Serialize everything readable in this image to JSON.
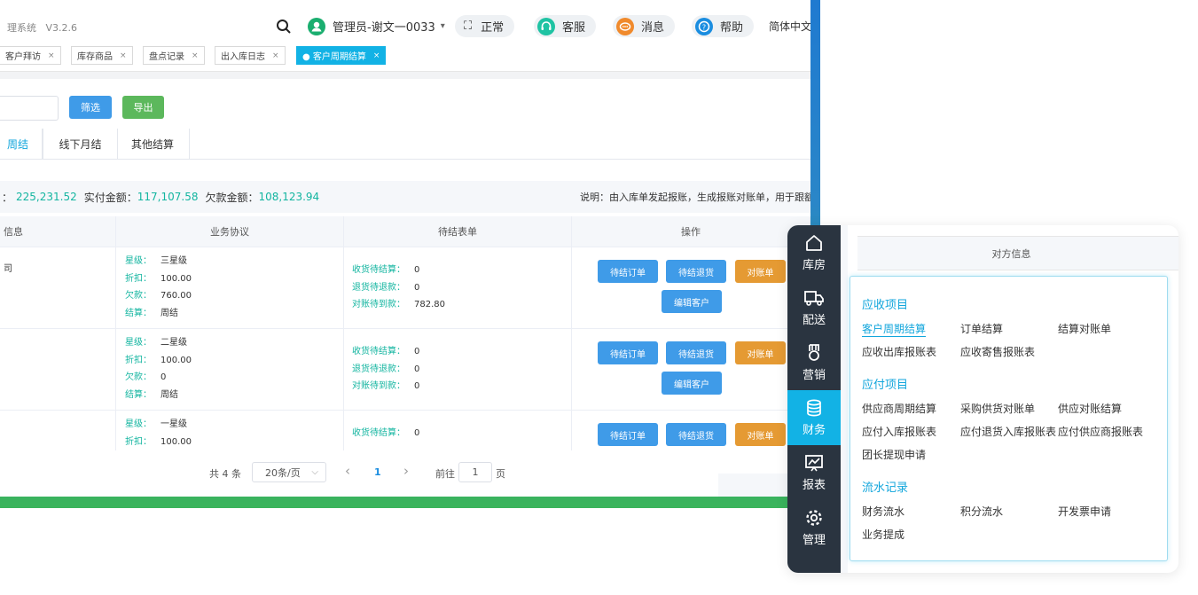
{
  "app": {
    "system_name": "理系统",
    "version": "V3.2.6"
  },
  "topbar": {
    "user": "管理员-谢文一0033",
    "status": "正常",
    "service": "客服",
    "messages": "消息",
    "help": "帮助",
    "language": "简体中文"
  },
  "tabs": [
    {
      "label": "客户拜访",
      "close": "×"
    },
    {
      "label": "库存商品",
      "close": "×"
    },
    {
      "label": "盘点记录",
      "close": "×"
    },
    {
      "label": "出入库日志",
      "close": "×"
    },
    {
      "label": "● 客户周期结算",
      "close": "×"
    }
  ],
  "toolbar": {
    "filter_label": "筛选",
    "export_label": "导出"
  },
  "subtabs": [
    "周结",
    "线下月结",
    "其他结算"
  ],
  "summary": {
    "total_suffix": "：",
    "total_value": "225,231.52",
    "paid_label": "实付金额：",
    "paid_value": "117,107.58",
    "debt_label": "欠款金额：",
    "debt_value": "108,123.94",
    "note": "说明：由入库单发起报账，生成报账对账单，用于跟额"
  },
  "table": {
    "headers": [
      "信息",
      "业务协议",
      "待结表单",
      "操作"
    ],
    "rows": [
      {
        "info": "司",
        "agreement": [
          [
            "星级：",
            "三星级"
          ],
          [
            "折扣：",
            "100.00"
          ],
          [
            "欠款：",
            "760.00"
          ],
          [
            "结算：",
            "周结"
          ]
        ],
        "pending": [
          [
            "收货待结算：",
            "0"
          ],
          [
            "退货待退款：",
            "0"
          ],
          [
            "对账待到款：",
            "782.80"
          ]
        ],
        "actions": [
          "待结订单",
          "待结退货",
          "对账单",
          "编辑客户"
        ]
      },
      {
        "info": "",
        "agreement": [
          [
            "星级：",
            "二星级"
          ],
          [
            "折扣：",
            "100.00"
          ],
          [
            "欠款：",
            "0"
          ],
          [
            "结算：",
            "周结"
          ]
        ],
        "pending": [
          [
            "收货待结算：",
            "0"
          ],
          [
            "退货待退款：",
            "0"
          ],
          [
            "对账待到款：",
            "0"
          ]
        ],
        "actions": [
          "待结订单",
          "待结退货",
          "对账单",
          "编辑客户"
        ]
      },
      {
        "info": "",
        "agreement": [
          [
            "星级：",
            "一星级"
          ],
          [
            "折扣：",
            "100.00"
          ]
        ],
        "pending": [
          [
            "收货待结算：",
            "0"
          ]
        ],
        "actions": [
          "待结订单",
          "待结退货",
          "对账单"
        ]
      }
    ]
  },
  "pager": {
    "total": "共 4 条",
    "page_size": "20条/页",
    "current": "1",
    "goto_label": "前往",
    "goto_value": "1",
    "page_suffix": "页",
    "prev": "‹",
    "next": "›",
    "dropdown": "⌵"
  },
  "sidenav": [
    {
      "label": "库房",
      "icon": "home-icon"
    },
    {
      "label": "配送",
      "icon": "truck-icon"
    },
    {
      "label": "营销",
      "icon": "medal-icon"
    },
    {
      "label": "财务",
      "icon": "database-icon",
      "active": true
    },
    {
      "label": "报表",
      "icon": "chart-icon"
    },
    {
      "label": "管理",
      "icon": "gear-icon"
    }
  ],
  "right_table_header": "对方信息",
  "finance_menu": {
    "receivable_title": "应收项目",
    "receivable": [
      "客户周期结算",
      "订单结算",
      "结算对账单",
      "应收出库报账表",
      "应收寄售报账表"
    ],
    "payable_title": "应付项目",
    "payable": [
      "供应商周期结算",
      "采购供货对账单",
      "供应对账结算",
      "应付入库报账表",
      "应付退货入库报账表",
      "应付供应商报账表",
      "团长提现申请"
    ],
    "flow_title": "流水记录",
    "flow": [
      "财务流水",
      "积分流水",
      "开发票申请",
      "业务提成"
    ]
  },
  "colors": {
    "accent": "#12b2e5",
    "blue_button": "#3f9be8",
    "orange_button": "#e59a33",
    "green_button": "#5cb85c",
    "nav_bg": "#2a3440"
  }
}
